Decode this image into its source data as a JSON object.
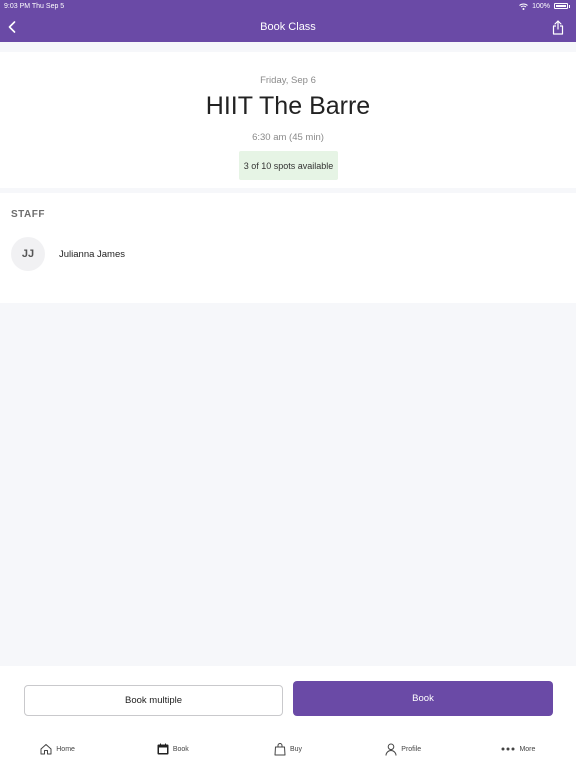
{
  "status_bar": {
    "time_date": "9:03 PM Thu Sep 5",
    "battery": "100%"
  },
  "nav": {
    "title": "Book Class"
  },
  "class": {
    "date": "Friday, Sep 6",
    "title": "HIIT The Barre",
    "time": "6:30 am (45 min)",
    "spots": "3 of 10 spots available"
  },
  "staff": {
    "heading": "STAFF",
    "members": [
      {
        "initials": "JJ",
        "name": "Julianna James"
      }
    ]
  },
  "actions": {
    "book_multiple": "Book multiple",
    "book": "Book"
  },
  "tabs": [
    {
      "label": "Home",
      "icon": "home-icon"
    },
    {
      "label": "Book",
      "icon": "calendar-icon"
    },
    {
      "label": "Buy",
      "icon": "shopping-bag-icon"
    },
    {
      "label": "Profile",
      "icon": "person-icon"
    },
    {
      "label": "More",
      "icon": "more-dots-icon"
    }
  ],
  "colors": {
    "brand": "#6a4aa6",
    "badge_bg": "#e6f4e5"
  }
}
